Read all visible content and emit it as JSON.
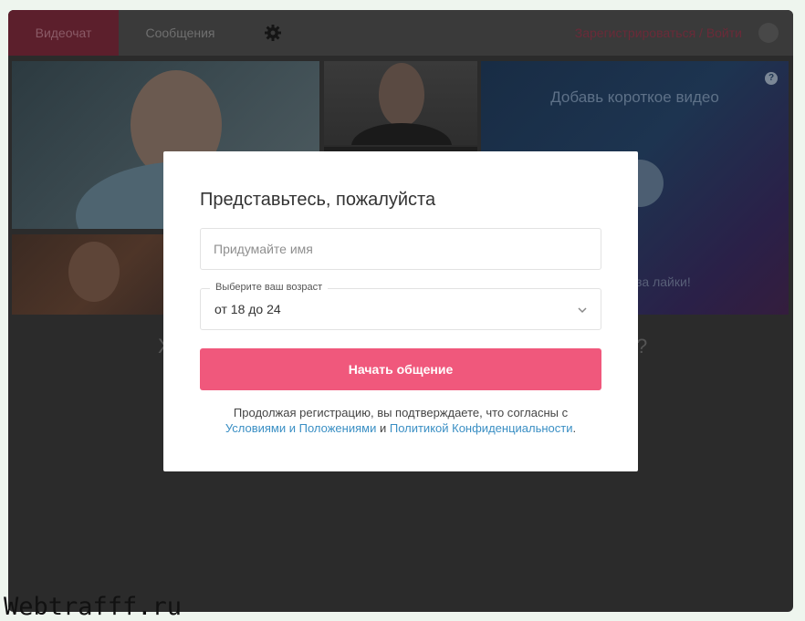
{
  "header": {
    "tabs": [
      {
        "label": "Видеочат",
        "active": true
      },
      {
        "label": "Сообщения",
        "active": false
      }
    ],
    "settings_icon": "gear-icon",
    "auth_link": "Зарегистрироваться / Войти",
    "avatar_icon": "user-avatar-icon"
  },
  "video_promo": {
    "title": "Добавь короткое видео",
    "help_icon_label": "?",
    "likes_text": "за лайки!"
  },
  "modal": {
    "title": "Представьтесь, пожалуйста",
    "name_placeholder": "Придумайте имя",
    "age_label": "Выберите ваш возраст",
    "age_value": "от 18 до 24",
    "start_button": "Начать общение",
    "consent_text": "Продолжая регистрацию, вы подтверждаете, что согласны с",
    "terms_link": "Условиями и Положениями",
    "and_text": "и",
    "privacy_link": "Политикой Конфиденциальности",
    "period": "."
  },
  "background_glyphs": {
    "left": "Х",
    "right": "?"
  },
  "watermark": "Webtrafff.ru",
  "colors": {
    "accent": "#f0587c",
    "link": "#3a8fc4",
    "overlay": "#2b2b2b"
  }
}
